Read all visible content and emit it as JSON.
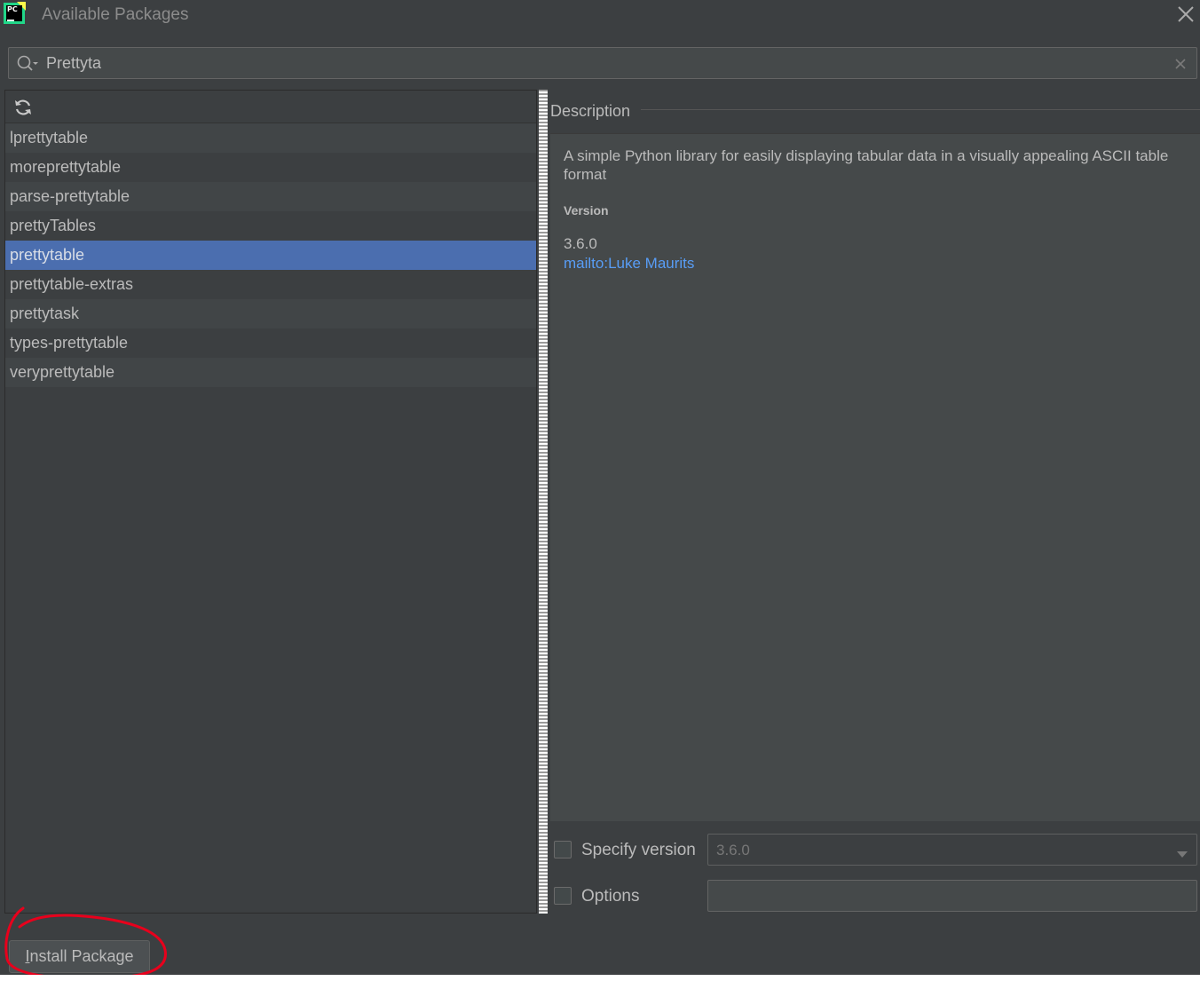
{
  "window": {
    "title": "Available Packages",
    "app_icon": "pycharm-logo",
    "app_icon_text": "PC"
  },
  "search": {
    "value": "Prettyta",
    "icon": "search-icon"
  },
  "packages": [
    {
      "name": "lprettytable",
      "selected": false
    },
    {
      "name": "moreprettytable",
      "selected": false
    },
    {
      "name": "parse-prettytable",
      "selected": false
    },
    {
      "name": "prettyTables",
      "selected": false
    },
    {
      "name": "prettytable",
      "selected": true
    },
    {
      "name": "prettytable-extras",
      "selected": false
    },
    {
      "name": "prettytask",
      "selected": false
    },
    {
      "name": "types-prettytable",
      "selected": false
    },
    {
      "name": "veryprettytable",
      "selected": false
    }
  ],
  "description": {
    "header": "Description",
    "text": "A simple Python library for easily displaying tabular data in a visually appealing ASCII table format",
    "version_label": "Version",
    "version": "3.6.0",
    "author_link": "mailto:Luke Maurits"
  },
  "options": {
    "specify_version_label": "Specify version",
    "specify_version_checked": false,
    "version_value": "3.6.0",
    "options_label": "Options",
    "options_checked": false,
    "options_value": ""
  },
  "actions": {
    "install_label": "Install Package"
  },
  "colors": {
    "background": "#3c3f41",
    "selection": "#4b6eaf",
    "link": "#589df6",
    "annotation": "#e8001c"
  }
}
